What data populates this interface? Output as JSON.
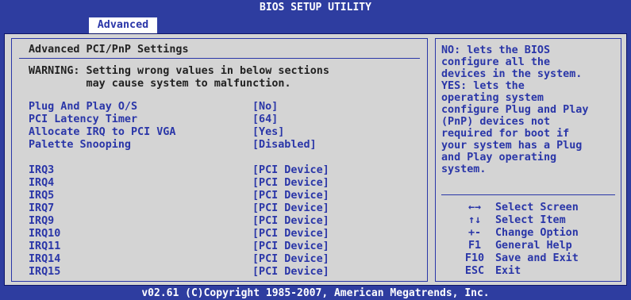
{
  "header": {
    "title": "BIOS SETUP UTILITY",
    "active_tab": "Advanced"
  },
  "main": {
    "section_title": "Advanced PCI/PnP Settings",
    "warning_line1": "WARNING: Setting wrong values in below sections",
    "warning_line2": "         may cause system to malfunction.",
    "settings": [
      {
        "label": "Plug And Play O/S",
        "value": "[No]"
      },
      {
        "label": "PCI Latency Timer",
        "value": "[64]"
      },
      {
        "label": "Allocate IRQ to PCI VGA",
        "value": "[Yes]"
      },
      {
        "label": "Palette Snooping",
        "value": "[Disabled]"
      }
    ],
    "irqs": [
      {
        "label": "IRQ3",
        "value": "[PCI Device]"
      },
      {
        "label": "IRQ4",
        "value": "[PCI Device]"
      },
      {
        "label": "IRQ5",
        "value": "[PCI Device]"
      },
      {
        "label": "IRQ7",
        "value": "[PCI Device]"
      },
      {
        "label": "IRQ9",
        "value": "[PCI Device]"
      },
      {
        "label": "IRQ10",
        "value": "[PCI Device]"
      },
      {
        "label": "IRQ11",
        "value": "[PCI Device]"
      },
      {
        "label": "IRQ14",
        "value": "[PCI Device]"
      },
      {
        "label": "IRQ15",
        "value": "[PCI Device]"
      }
    ]
  },
  "help": {
    "lines": [
      "NO: lets the BIOS",
      "configure all the",
      "devices in the system.",
      "YES: lets the",
      "operating system",
      "configure Plug and Play",
      "(PnP) devices not",
      "required for boot if",
      "your system has a Plug",
      "and Play operating",
      "system."
    ],
    "keys": [
      {
        "key": "←→",
        "desc": "Select Screen"
      },
      {
        "key": "↑↓",
        "desc": "Select Item"
      },
      {
        "key": "+-",
        "desc": "Change Option"
      },
      {
        "key": "F1",
        "desc": "General Help"
      },
      {
        "key": "F10",
        "desc": "Save and Exit"
      },
      {
        "key": "ESC",
        "desc": "Exit"
      }
    ]
  },
  "footer": {
    "copyright": "v02.61 (C)Copyright 1985-2007, American Megatrends, Inc."
  }
}
